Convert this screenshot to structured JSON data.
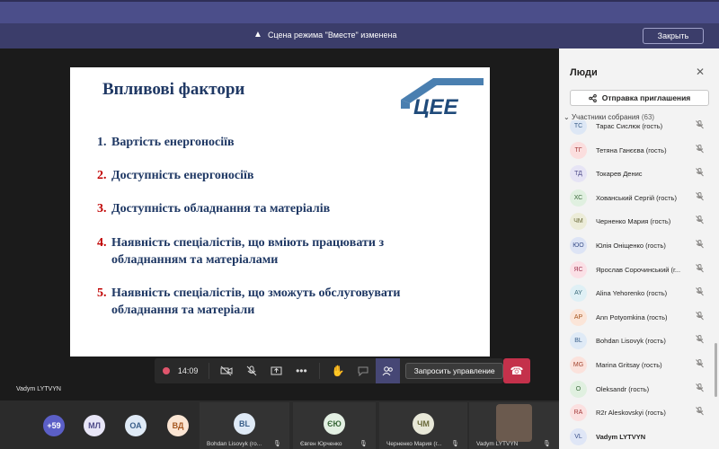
{
  "notification": {
    "message": "Сцена режима \"Вместе\" изменена",
    "close_label": "Закрыть"
  },
  "slide": {
    "title": "Впливові фактори",
    "logo_text": "ЦЕЕ",
    "items": [
      {
        "num": "1.",
        "text": "Вартість енергоносіїв",
        "num_color": "#1f3864"
      },
      {
        "num": "2.",
        "text": "Доступність енергоносіїв",
        "num_color": "#c00000"
      },
      {
        "num": "3.",
        "text": "Доступність обладнання та матеріалів",
        "num_color": "#c00000"
      },
      {
        "num": "4.",
        "text": "Наявність спеціалістів, що вміють працювати з обладнанням та матеріалами",
        "num_color": "#c00000"
      },
      {
        "num": "5.",
        "text": "Наявність спеціалістів, що зможуть обслуговувати обладнання та матеріали",
        "num_color": "#c00000"
      }
    ]
  },
  "presenter": "Vadym LYTVYN",
  "callbar": {
    "timer": "14:09",
    "request_control_label": "Запросить управление"
  },
  "strip": {
    "overflow_count": "+59",
    "avatars": [
      {
        "initials": "МЛ",
        "bg": "#e8e6f7",
        "fg": "#4f4b8a"
      },
      {
        "initials": "ОА",
        "bg": "#dfeaf6",
        "fg": "#3a5f8a"
      },
      {
        "initials": "ВД",
        "bg": "#fbe5d3",
        "fg": "#a5561f"
      }
    ],
    "tiles": [
      {
        "initials": "BL",
        "name": "Bohdan Lisovyk (го...",
        "bg": "#dfeaf6",
        "fg": "#3a5f8a"
      },
      {
        "initials": "ЄЮ",
        "name": "Євген Юрченко",
        "bg": "#e3f0e3",
        "fg": "#3c6a3c"
      },
      {
        "initials": "ЧМ",
        "name": "Черненко Мария (г...",
        "bg": "#e8e8d8",
        "fg": "#6a6a3a"
      },
      {
        "initials": "",
        "name": "Vadym LYTVYN",
        "bg": "#555555",
        "fg": "#ffffff"
      }
    ]
  },
  "panel": {
    "title": "Люди",
    "invite_label": "Отправка приглашения",
    "section_label": "Участники собрания",
    "section_count": "(63)",
    "participants": [
      {
        "initials": "ТС",
        "name": "Тарас Сислюк (гость)",
        "bg": "#dde7f5",
        "fg": "#3a5f8a",
        "bold": false
      },
      {
        "initials": "ТГ",
        "name": "Тетяна Ганєєва (гость)",
        "bg": "#fbdede",
        "fg": "#a33a3a",
        "bold": false
      },
      {
        "initials": "ТД",
        "name": "Токарев Денис",
        "bg": "#e6e4f5",
        "fg": "#4f4b8a",
        "bold": false
      },
      {
        "initials": "ХС",
        "name": "Хованський Сергій (гость)",
        "bg": "#e0f0e0",
        "fg": "#3c6a3c",
        "bold": false
      },
      {
        "initials": "ЧМ",
        "name": "Черненко Мария (гость)",
        "bg": "#ececd8",
        "fg": "#6a6a3a",
        "bold": false
      },
      {
        "initials": "ЮО",
        "name": "Юлія Оніщенко (гость)",
        "bg": "#dde4f5",
        "fg": "#3a4f8a",
        "bold": false
      },
      {
        "initials": "ЯС",
        "name": "Ярослав Сорочинський (г...",
        "bg": "#fbe0e6",
        "fg": "#a33a55",
        "bold": false
      },
      {
        "initials": "AY",
        "name": "Alina Yehorenko (гость)",
        "bg": "#dff0f5",
        "fg": "#3a6a7a",
        "bold": false
      },
      {
        "initials": "AP",
        "name": "Ann Potyomkina (гость)",
        "bg": "#fbe5d8",
        "fg": "#a5561f",
        "bold": false
      },
      {
        "initials": "BL",
        "name": "Bohdan Lisovyk (гость)",
        "bg": "#dfeaf6",
        "fg": "#3a5f8a",
        "bold": false
      },
      {
        "initials": "MG",
        "name": "Marina Gritsay (гость)",
        "bg": "#fbe2dc",
        "fg": "#a3442f",
        "bold": false
      },
      {
        "initials": "O",
        "name": "Oleksandr (гость)",
        "bg": "#e0f0e0",
        "fg": "#3c6a3c",
        "bold": false
      },
      {
        "initials": "RA",
        "name": "R2r Aleskovskyi (гость)",
        "bg": "#fbe0e0",
        "fg": "#a33a3a",
        "bold": false
      },
      {
        "initials": "VL",
        "name": "Vadym LYTVYN",
        "bg": "#dfe6f6",
        "fg": "#3a4f8a",
        "bold": true
      }
    ]
  }
}
